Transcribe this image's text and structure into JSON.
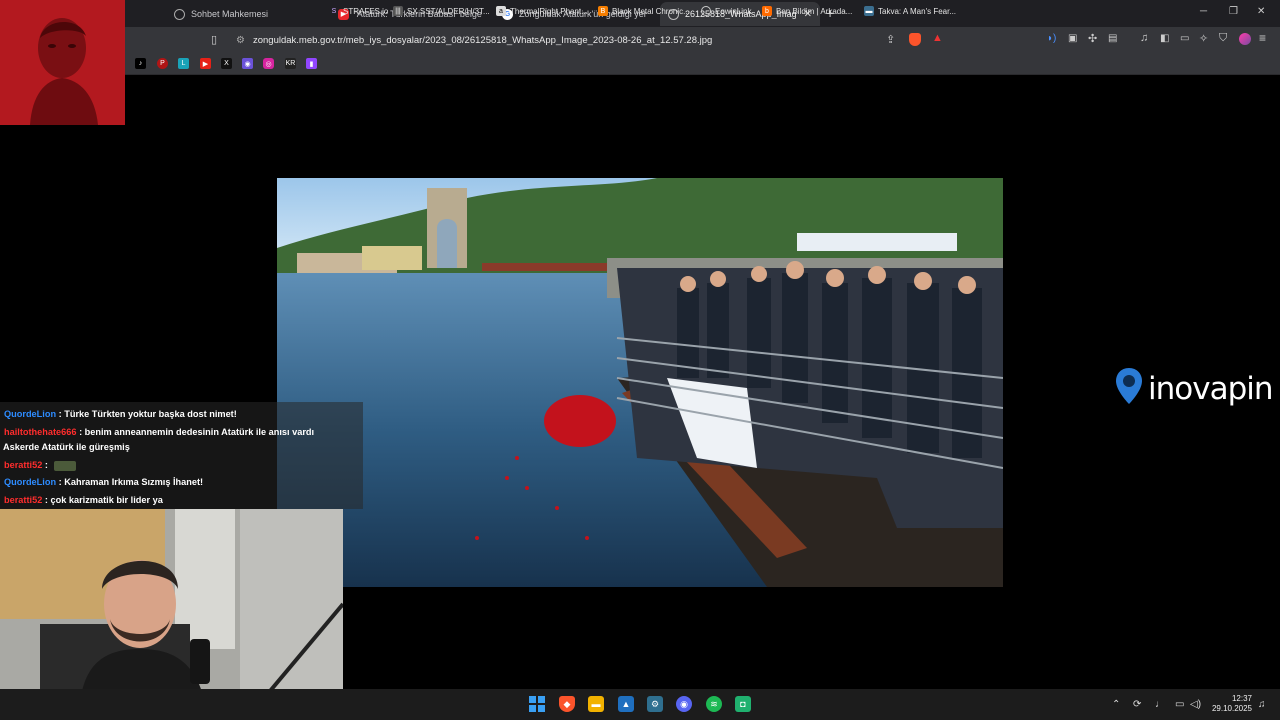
{
  "browser": {
    "tabs": [
      {
        "title": "Sohbet Mahkemesi",
        "icon": "globe-icon",
        "active": false
      },
      {
        "title": "'Atatürk: Türklerin Babası' belgeseli",
        "icon": "youtube-icon",
        "active": false
      },
      {
        "title": "Zonguldak Atatürk'ün geldiği yer - G",
        "icon": "google-icon",
        "active": false
      },
      {
        "title": "26125818_WhatsApp_Image_20",
        "icon": "globe-icon",
        "active": true
      }
    ],
    "new_tab": "+",
    "url": "zonguldak.meb.gov.tr/meb_iys_dosyalar/2023_08/26125818_WhatsApp_Image_2023-08-26_at_12.57.28.jpg",
    "bookmarks": [
      {
        "label": "STRAFES.io",
        "icon": "strafes-icon"
      },
      {
        "label": "SX SST/ALDER/H/3T...",
        "icon": "sx-icon"
      },
      {
        "label": "ThermalRight Phant...",
        "icon": "thermalright-icon"
      },
      {
        "label": "Black Metal Chronic...",
        "icon": "blogger-icon"
      },
      {
        "label": "EowinLink",
        "icon": "eowin-icon"
      },
      {
        "label": "Ben Bildim | Arkada...",
        "icon": "benbildim-icon"
      },
      {
        "label": "Takva: A Man's Fear...",
        "icon": "movie-icon"
      }
    ]
  },
  "overlay": {
    "sponsor_logo": "inovapin",
    "chat": [
      {
        "user": "QuordeLion",
        "user_color": "#2e8cff",
        "message": ": Türke Türkten yoktur başka dost nimet!"
      },
      {
        "user": "hailtothehate666",
        "user_color": "#ff2d2d",
        "message": ": benim anneannemin dedesinin Atatürk ile anısı vardı"
      },
      {
        "user": "",
        "user_color": "#ffffff",
        "message": "Askerde Atatürk ile güreşmiş"
      },
      {
        "user": "beratti52",
        "user_color": "#ff2d2d",
        "message": ":",
        "emote": true
      },
      {
        "user": "QuordeLion",
        "user_color": "#2e8cff",
        "message": ": Kahraman Irkıma Sızmış İhanet!"
      },
      {
        "user": "beratti52",
        "user_color": "#ff2d2d",
        "message": ": çok karizmatik bir lider ya"
      }
    ]
  },
  "taskbar": {
    "time": "12:37",
    "date": "29.10.2025",
    "accent": "#3ce35a"
  }
}
